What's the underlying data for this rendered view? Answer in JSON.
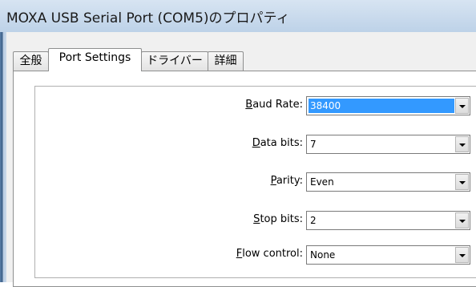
{
  "window": {
    "title": "MOXA USB Serial Port (COM5)のプロパティ"
  },
  "tabs": [
    {
      "label": "全般",
      "active": false
    },
    {
      "label": "Port Settings",
      "active": true
    },
    {
      "label": "ドライバー",
      "active": false
    },
    {
      "label": "詳細",
      "active": false
    }
  ],
  "port_settings": {
    "baud_rate": {
      "label_key": "B",
      "label_rest": "aud Rate:",
      "value": "38400",
      "icon": "chevron-down-icon"
    },
    "data_bits": {
      "label_key": "D",
      "label_rest": "ata bits:",
      "value": "7",
      "icon": "chevron-down-icon"
    },
    "parity": {
      "label_pre": "",
      "label_key": "P",
      "label_rest": "arity:",
      "value": "Even",
      "icon": "chevron-down-icon"
    },
    "stop_bits": {
      "label_key": "S",
      "label_rest": "top bits:",
      "value": "2",
      "icon": "chevron-down-icon"
    },
    "flow_control": {
      "label_key": "F",
      "label_rest": "low control:",
      "value": "None",
      "icon": "chevron-down-icon"
    }
  },
  "colors": {
    "selection": "#3399ff",
    "title_bar": "#bdd2e8",
    "panel": "#ffffff"
  }
}
